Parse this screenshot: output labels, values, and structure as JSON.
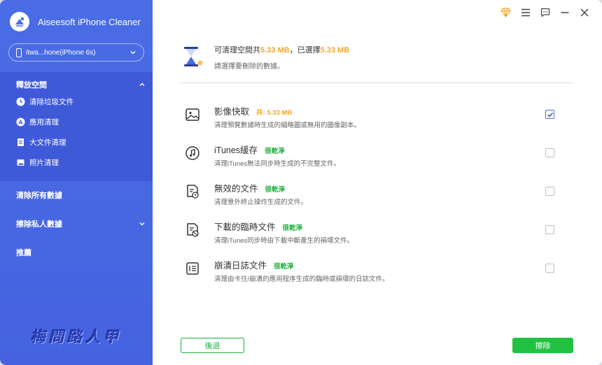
{
  "app": {
    "title": "Aiseesoft iPhone Cleaner"
  },
  "device": {
    "name": "itwa...hone(iPhone 6s)"
  },
  "sidebar": {
    "free_space": {
      "label": "釋放空間",
      "items": [
        {
          "label": "清除垃圾文件",
          "icon": "clock-icon"
        },
        {
          "label": "應用清理",
          "icon": "app-store-icon"
        },
        {
          "label": "大文件清理",
          "icon": "file-icon"
        },
        {
          "label": "照片清理",
          "icon": "image-icon"
        }
      ]
    },
    "erase_all": "清除所有數據",
    "erase_private": "擦除私人數據",
    "recommend": "推薦"
  },
  "watermark": "梅問路人甲",
  "summary": {
    "prefix": "可清理空間共",
    "total": "5.33 MB",
    "mid": "，已選擇",
    "selected": "5.33 MB",
    "hint": "請選擇要刪除的數據。"
  },
  "items": [
    {
      "title": "影像快取",
      "tag": "共: 5.33 MB",
      "tag_color": "#f2a72e",
      "desc": "清理預覽數據時生成的縮略圖或無用的圖像副本。",
      "checked": true,
      "icon": "image-icon"
    },
    {
      "title": "iTunes緩存",
      "tag": "很乾淨",
      "tag_color": "#1bb13d",
      "desc": "清理iTunes無法同步時生成的不完整文件。",
      "checked": false,
      "icon": "music-note-icon"
    },
    {
      "title": "無效的文件",
      "tag": "很乾淨",
      "tag_color": "#1bb13d",
      "desc": "清理意外終止操作生成的文件。",
      "checked": false,
      "icon": "file-clock-icon"
    },
    {
      "title": "下載的臨時文件",
      "tag": "很乾淨",
      "tag_color": "#1bb13d",
      "desc": "清理iTunes同步時由下載中斷產生的損壞文件。",
      "checked": false,
      "icon": "file-blocked-icon"
    },
    {
      "title": "崩潰日誌文件",
      "tag": "很乾淨",
      "tag_color": "#1bb13d",
      "desc": "清理由卡住/崩潰的應用程序生成的臨時或損壞的日誌文件。",
      "checked": false,
      "icon": "log-list-icon"
    }
  ],
  "buttons": {
    "back": "後退",
    "clean": "擦除"
  },
  "colors": {
    "sidebar": "#4a6ce6",
    "accent_orange": "#f2a72e",
    "green": "#21c241"
  }
}
